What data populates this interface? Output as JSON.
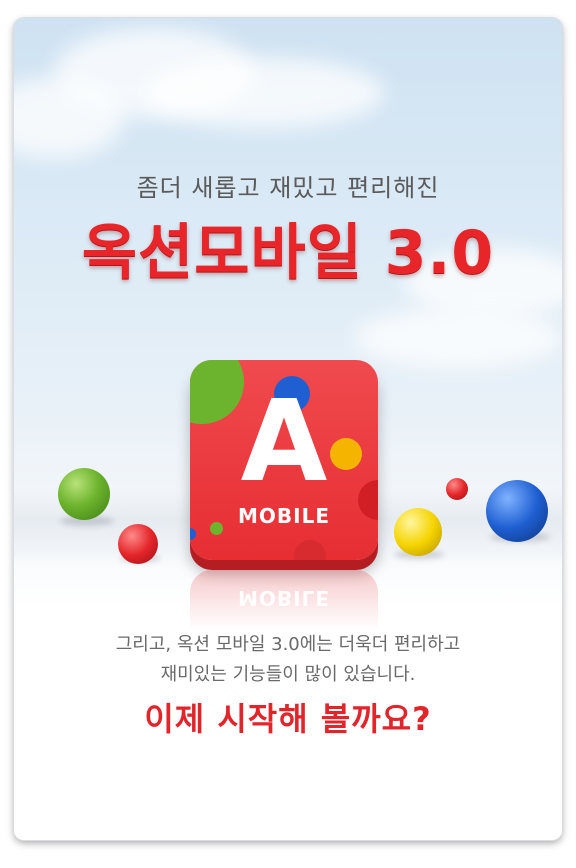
{
  "intro": {
    "subtitle": "좀더 새롭고 재밌고 편리해진",
    "title": "옥션모바일 3.0"
  },
  "app_icon": {
    "letter": "A",
    "label": "MOBILE",
    "reflection_label": "MOBILE"
  },
  "description": {
    "line1": "그리고, 옥션 모바일 3.0에는 더욱더 편리하고",
    "line2": "재미있는 기능들이 많이 있습니다."
  },
  "call_to_action": "이제 시작해 볼까요?",
  "colors": {
    "brand_red": "#e8262a",
    "icon_red": "#ee3c40",
    "green": "#6db42e",
    "yellow": "#f5d400",
    "blue": "#1f5fd1",
    "text_gray": "#5a5a5a"
  }
}
